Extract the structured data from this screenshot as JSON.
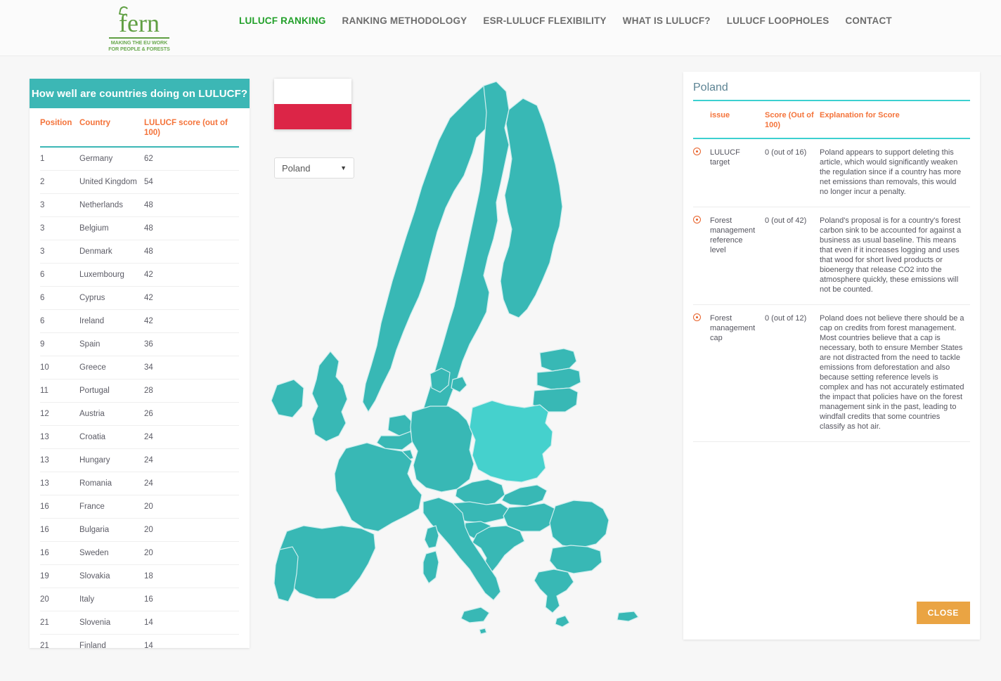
{
  "header": {
    "logo": {
      "word": "fern",
      "tagline_line1": "MAKING THE EU WORK",
      "tagline_line2": "FOR PEOPLE & FORESTS"
    },
    "nav": [
      {
        "label": "LULUCF RANKING",
        "active": true
      },
      {
        "label": "RANKING METHODOLOGY",
        "active": false
      },
      {
        "label": "ESR-LULUCF FLEXIBILITY",
        "active": false
      },
      {
        "label": "WHAT IS LULUCF?",
        "active": false
      },
      {
        "label": "LULUCF LOOPHOLES",
        "active": false
      },
      {
        "label": "CONTACT",
        "active": false
      }
    ]
  },
  "ranking": {
    "title": "How well are countries doing on LULUCF?",
    "columns": [
      "Position",
      "Country",
      "LULUCF score (out of 100)"
    ],
    "rows": [
      {
        "position": "1",
        "country": "Germany",
        "score": "62"
      },
      {
        "position": "2",
        "country": "United Kingdom",
        "score": "54"
      },
      {
        "position": "3",
        "country": "Netherlands",
        "score": "48"
      },
      {
        "position": "3",
        "country": "Belgium",
        "score": "48"
      },
      {
        "position": "3",
        "country": "Denmark",
        "score": "48"
      },
      {
        "position": "6",
        "country": "Luxembourg",
        "score": "42"
      },
      {
        "position": "6",
        "country": "Cyprus",
        "score": "42"
      },
      {
        "position": "6",
        "country": "Ireland",
        "score": "42"
      },
      {
        "position": "9",
        "country": "Spain",
        "score": "36"
      },
      {
        "position": "10",
        "country": "Greece",
        "score": "34"
      },
      {
        "position": "11",
        "country": "Portugal",
        "score": "28"
      },
      {
        "position": "12",
        "country": "Austria",
        "score": "26"
      },
      {
        "position": "13",
        "country": "Croatia",
        "score": "24"
      },
      {
        "position": "13",
        "country": "Hungary",
        "score": "24"
      },
      {
        "position": "13",
        "country": "Romania",
        "score": "24"
      },
      {
        "position": "16",
        "country": "France",
        "score": "20"
      },
      {
        "position": "16",
        "country": "Bulgaria",
        "score": "20"
      },
      {
        "position": "16",
        "country": "Sweden",
        "score": "20"
      },
      {
        "position": "19",
        "country": "Slovakia",
        "score": "18"
      },
      {
        "position": "20",
        "country": "Italy",
        "score": "16"
      },
      {
        "position": "21",
        "country": "Slovenia",
        "score": "14"
      },
      {
        "position": "21",
        "country": "Finland",
        "score": "14"
      }
    ]
  },
  "map": {
    "selected_country": "Poland",
    "select_caret": "▼",
    "flag": {
      "top_color": "#ffffff",
      "bottom_color": "#dc2547"
    },
    "colors": {
      "country_fill": "#38b8b5",
      "selected_fill": "#45d1cd",
      "border": "#cfeeee",
      "background": "#f7f7f7"
    }
  },
  "detail": {
    "title": "Poland",
    "columns": [
      "",
      "issue",
      "Score (Out of 100)",
      "Explanation for Score"
    ],
    "rows": [
      {
        "icon": "target-dot-icon",
        "issue": "LULUCF target",
        "score": "0 (out of 16)",
        "explanation": "Poland appears to support deleting this article, which would significantly weaken the regulation since if a country has more net emissions than removals, this would no longer incur a penalty."
      },
      {
        "icon": "target-dot-icon",
        "issue": "Forest management reference level",
        "score": "0 (out of 42)",
        "explanation": "Poland's proposal is for a country's forest carbon sink to be accounted for against a business as usual baseline. This means that even if it increases logging and uses that wood for short lived products or bioenergy that release CO2 into the atmosphere quickly, these emissions will not be counted."
      },
      {
        "icon": "target-dot-icon",
        "issue": "Forest management cap",
        "score": "0 (out of 12)",
        "explanation": "Poland does not believe there should be a cap on credits from forest management. Most countries believe that a cap is necessary, both to ensure Member States are not distracted from the need to tackle emissions from deforestation and also because setting reference levels is complex and has not accurately estimated the impact that policies have on the forest management sink in the past, leading to windfall credits that some countries classify as hot air."
      }
    ],
    "close_label": "CLOSE"
  }
}
